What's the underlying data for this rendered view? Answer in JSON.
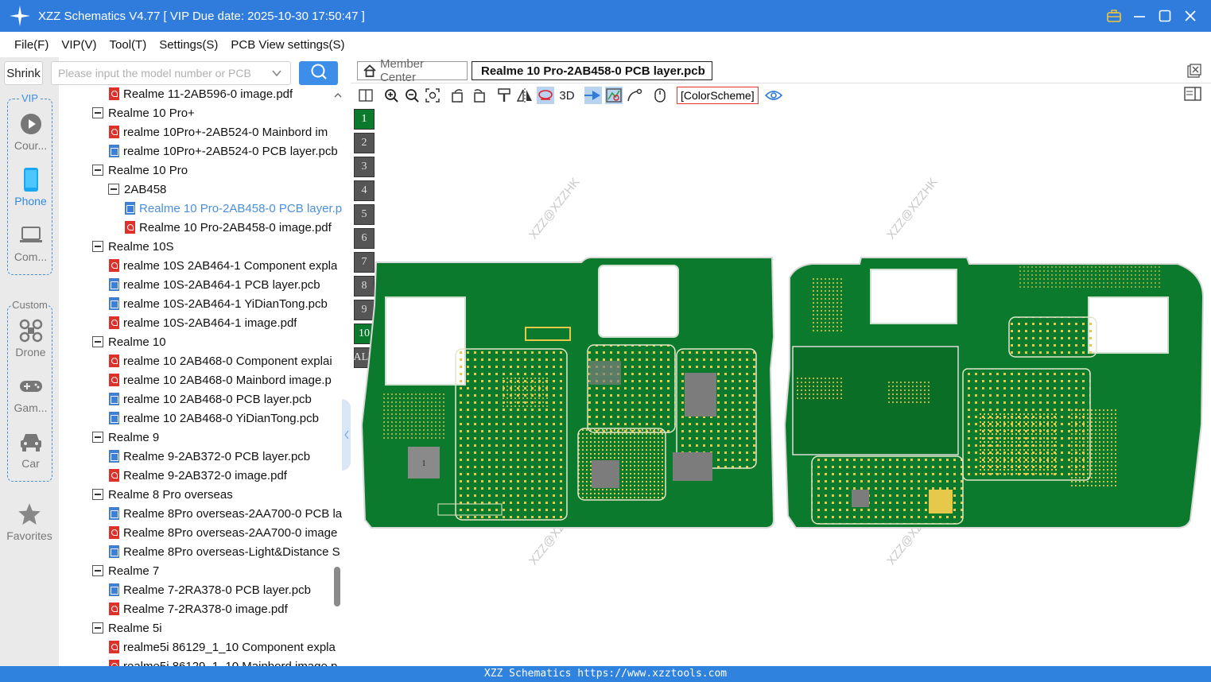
{
  "window": {
    "title": "XZZ Schematics V4.77 [ VIP Due date: 2025-10-30 17:50:47 ]"
  },
  "menu": [
    "File(F)",
    "VIP(V)",
    "Tool(T)",
    "Settings(S)",
    "PCB View settings(S)"
  ],
  "sidebar": {
    "shrink_label": "Shrink",
    "vip_label": "VIP",
    "vip_items": [
      {
        "label": "Cour...",
        "icon": "play-circle-icon"
      },
      {
        "label": "Phone",
        "icon": "phone-icon"
      },
      {
        "label": "Com...",
        "icon": "laptop-icon"
      }
    ],
    "custom_label": "Custom",
    "custom_items": [
      {
        "label": "Drone",
        "icon": "drone-icon"
      },
      {
        "label": "Gam...",
        "icon": "gamepad-icon"
      },
      {
        "label": "Car",
        "icon": "car-icon"
      }
    ],
    "favorites_label": "Favorites"
  },
  "search": {
    "placeholder": "Please input the model number or PCB"
  },
  "tree": [
    {
      "text": "Realme 11-2AB596-0 image.pdf",
      "type": "pdf",
      "indent": 1
    },
    {
      "text": "Realme 10 Pro+",
      "type": "folder",
      "indent": 0
    },
    {
      "text": "realme 10Pro+-2AB524-0 Mainbord im",
      "type": "pdf",
      "indent": 1
    },
    {
      "text": "realme 10Pro+-2AB524-0 PCB layer.pcb",
      "type": "pcb",
      "indent": 1
    },
    {
      "text": "Realme 10 Pro",
      "type": "folder",
      "indent": 0
    },
    {
      "text": "2AB458",
      "type": "folder",
      "indent": 1
    },
    {
      "text": "Realme 10 Pro-2AB458-0 PCB layer.p",
      "type": "pcb",
      "indent": 2,
      "selected": true
    },
    {
      "text": "Realme 10 Pro-2AB458-0 image.pdf",
      "type": "pdf",
      "indent": 2
    },
    {
      "text": "Realme 10S",
      "type": "folder",
      "indent": 0
    },
    {
      "text": "realme 10S 2AB464-1 Component expla",
      "type": "pdf",
      "indent": 1
    },
    {
      "text": "realme 10S-2AB464-1 PCB layer.pcb",
      "type": "pcb",
      "indent": 1
    },
    {
      "text": "realme 10S-2AB464-1 YiDianTong.pcb",
      "type": "pcb",
      "indent": 1
    },
    {
      "text": "realme 10S-2AB464-1 image.pdf",
      "type": "pdf",
      "indent": 1
    },
    {
      "text": "Realme 10",
      "type": "folder",
      "indent": 0
    },
    {
      "text": "realme 10 2AB468-0 Component explai",
      "type": "pdf",
      "indent": 1
    },
    {
      "text": "realme 10 2AB468-0 Mainbord image.p",
      "type": "pdf",
      "indent": 1
    },
    {
      "text": "realme 10 2AB468-0 PCB layer.pcb",
      "type": "pcb",
      "indent": 1
    },
    {
      "text": "realme 10 2AB468-0 YiDianTong.pcb",
      "type": "pcb",
      "indent": 1
    },
    {
      "text": "Realme 9",
      "type": "folder",
      "indent": 0
    },
    {
      "text": "Realme 9-2AB372-0 PCB layer.pcb",
      "type": "pcb",
      "indent": 1
    },
    {
      "text": "Realme 9-2AB372-0 image.pdf",
      "type": "pdf",
      "indent": 1
    },
    {
      "text": "Realme 8 Pro overseas",
      "type": "folder",
      "indent": 0
    },
    {
      "text": "Realme 8Pro overseas-2AA700-0 PCB la",
      "type": "pcb",
      "indent": 1
    },
    {
      "text": "Realme 8Pro overseas-2AA700-0 image",
      "type": "pdf",
      "indent": 1
    },
    {
      "text": "Realme 8Pro overseas-Light&Distance S",
      "type": "pcb",
      "indent": 1
    },
    {
      "text": "Realme 7",
      "type": "folder",
      "indent": 0
    },
    {
      "text": "Realme 7-2RA378-0 PCB layer.pcb",
      "type": "pcb",
      "indent": 1
    },
    {
      "text": "Realme 7-2RA378-0 image.pdf",
      "type": "pdf",
      "indent": 1
    },
    {
      "text": "Realme 5i",
      "type": "folder",
      "indent": 0
    },
    {
      "text": "realme5i 86129_1_10 Component expla",
      "type": "pdf",
      "indent": 1
    },
    {
      "text": "realme5i 86129_1_10 Mainbord image.p",
      "type": "pdf",
      "indent": 1
    }
  ],
  "tabs": {
    "member_center": "Member Center",
    "active_file": "Realme 10 Pro-2AB458-0 PCB layer.pcb"
  },
  "toolbar": {
    "three_d": "3D",
    "color_scheme": "[ColorScheme]"
  },
  "layers": [
    "1",
    "2",
    "3",
    "4",
    "5",
    "6",
    "7",
    "8",
    "9",
    "10",
    "ALL"
  ],
  "board_marker": "1",
  "watermark": "XZZ@XZZHK",
  "footer": "XZZ Schematics https://www.xzztools.com",
  "colors": {
    "accent": "#2f7cdd",
    "pcb_green": "#0b7a2c",
    "pad_yellow": "#e6c84a"
  }
}
